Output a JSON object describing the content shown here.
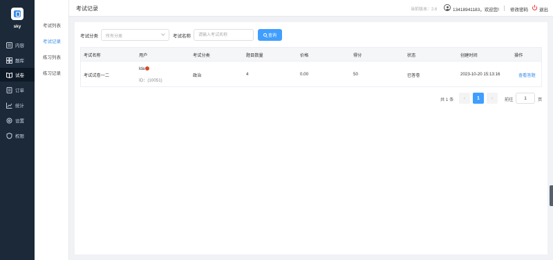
{
  "app": {
    "name": "sky"
  },
  "sidebar": {
    "items": [
      {
        "label": "内容",
        "icon": "content-icon"
      },
      {
        "label": "题库",
        "icon": "question-bank-icon"
      },
      {
        "label": "试卷",
        "icon": "exam-paper-icon",
        "active": true
      },
      {
        "label": "订单",
        "icon": "order-icon"
      },
      {
        "label": "统计",
        "icon": "stats-icon"
      },
      {
        "label": "设置",
        "icon": "settings-icon"
      },
      {
        "label": "权限",
        "icon": "permission-icon"
      }
    ]
  },
  "subnav": {
    "items": [
      {
        "label": "考试列表"
      },
      {
        "label": "考试记录",
        "active": true
      },
      {
        "label": "练习列表"
      },
      {
        "label": "练习记录"
      }
    ]
  },
  "header": {
    "title": "考试记录",
    "version": "当前版本：2.6",
    "welcome": "13418941183，欢迎您!",
    "change_password": "修改密码",
    "logout": "退出"
  },
  "filters": {
    "category_label": "考试分类",
    "category_value": "所有分类",
    "name_label": "考试名称",
    "name_placeholder": "请输入考试名称",
    "query_button": "查询"
  },
  "table": {
    "headers": [
      "考试名称",
      "用户",
      "考试分类",
      "题目数量",
      "价格",
      "得分",
      "状态",
      "创建时间",
      "操作"
    ],
    "rows": [
      {
        "exam_name": "考试试卷一二",
        "user_name": "lda",
        "user_id": "ID：(10051)",
        "category": "政治",
        "question_count": "4",
        "price": "0.00",
        "score": "50",
        "status": "已答卷",
        "created_at": "2023-10-20 15:13:16",
        "action": "查看答题"
      }
    ]
  },
  "pagination": {
    "total": "共 1 条",
    "prev": "‹",
    "current": "1",
    "next": "›",
    "goto_label": "前往",
    "goto_value": "1",
    "page_suffix": "页"
  },
  "colors": {
    "sidebar_bg": "#1c2939",
    "accent": "#409eff",
    "logout": "#e33333"
  }
}
